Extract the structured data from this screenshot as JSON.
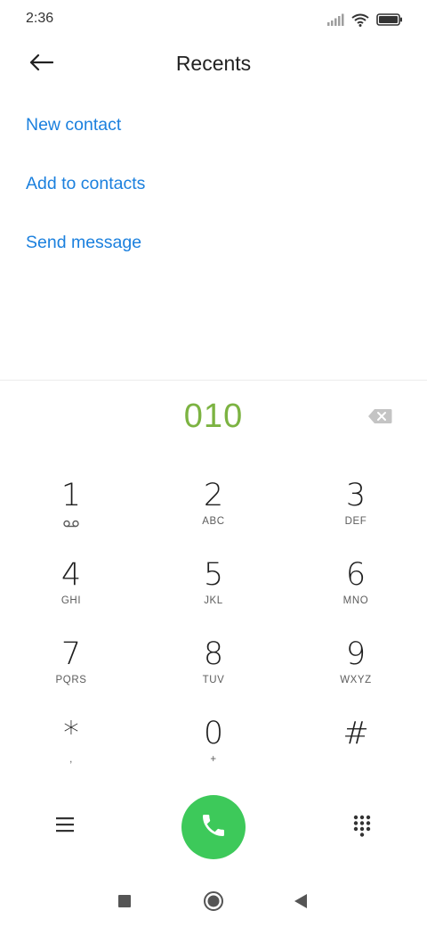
{
  "status_bar": {
    "time": "2:36",
    "icons": [
      "signal-icon",
      "wifi-icon",
      "battery-icon"
    ]
  },
  "header": {
    "title": "Recents",
    "back_icon": "back-arrow-icon"
  },
  "actions": [
    {
      "label": "New contact"
    },
    {
      "label": "Add to contacts"
    },
    {
      "label": "Send message"
    }
  ],
  "dialer": {
    "number": "010",
    "backspace_icon": "backspace-icon",
    "keys": [
      {
        "digit": "1",
        "letters": "",
        "icon": "voicemail-icon"
      },
      {
        "digit": "2",
        "letters": "ABC"
      },
      {
        "digit": "3",
        "letters": "DEF"
      },
      {
        "digit": "4",
        "letters": "GHI"
      },
      {
        "digit": "5",
        "letters": "JKL"
      },
      {
        "digit": "6",
        "letters": "MNO"
      },
      {
        "digit": "7",
        "letters": "PQRS"
      },
      {
        "digit": "8",
        "letters": "TUV"
      },
      {
        "digit": "9",
        "letters": "WXYZ"
      },
      {
        "digit": "*",
        "letters": ","
      },
      {
        "digit": "0",
        "letters": "+"
      },
      {
        "digit": "#",
        "letters": ""
      }
    ]
  },
  "controls": {
    "menu_icon": "menu-icon",
    "call_icon": "phone-icon",
    "dialpad_icon": "dialpad-icon"
  },
  "nav_bar": {
    "icons": [
      "recents-square-icon",
      "home-circle-icon",
      "back-triangle-icon"
    ]
  },
  "colors": {
    "accent_blue": "#1b80de",
    "number_green": "#7cb342",
    "call_green": "#3dc95a"
  }
}
